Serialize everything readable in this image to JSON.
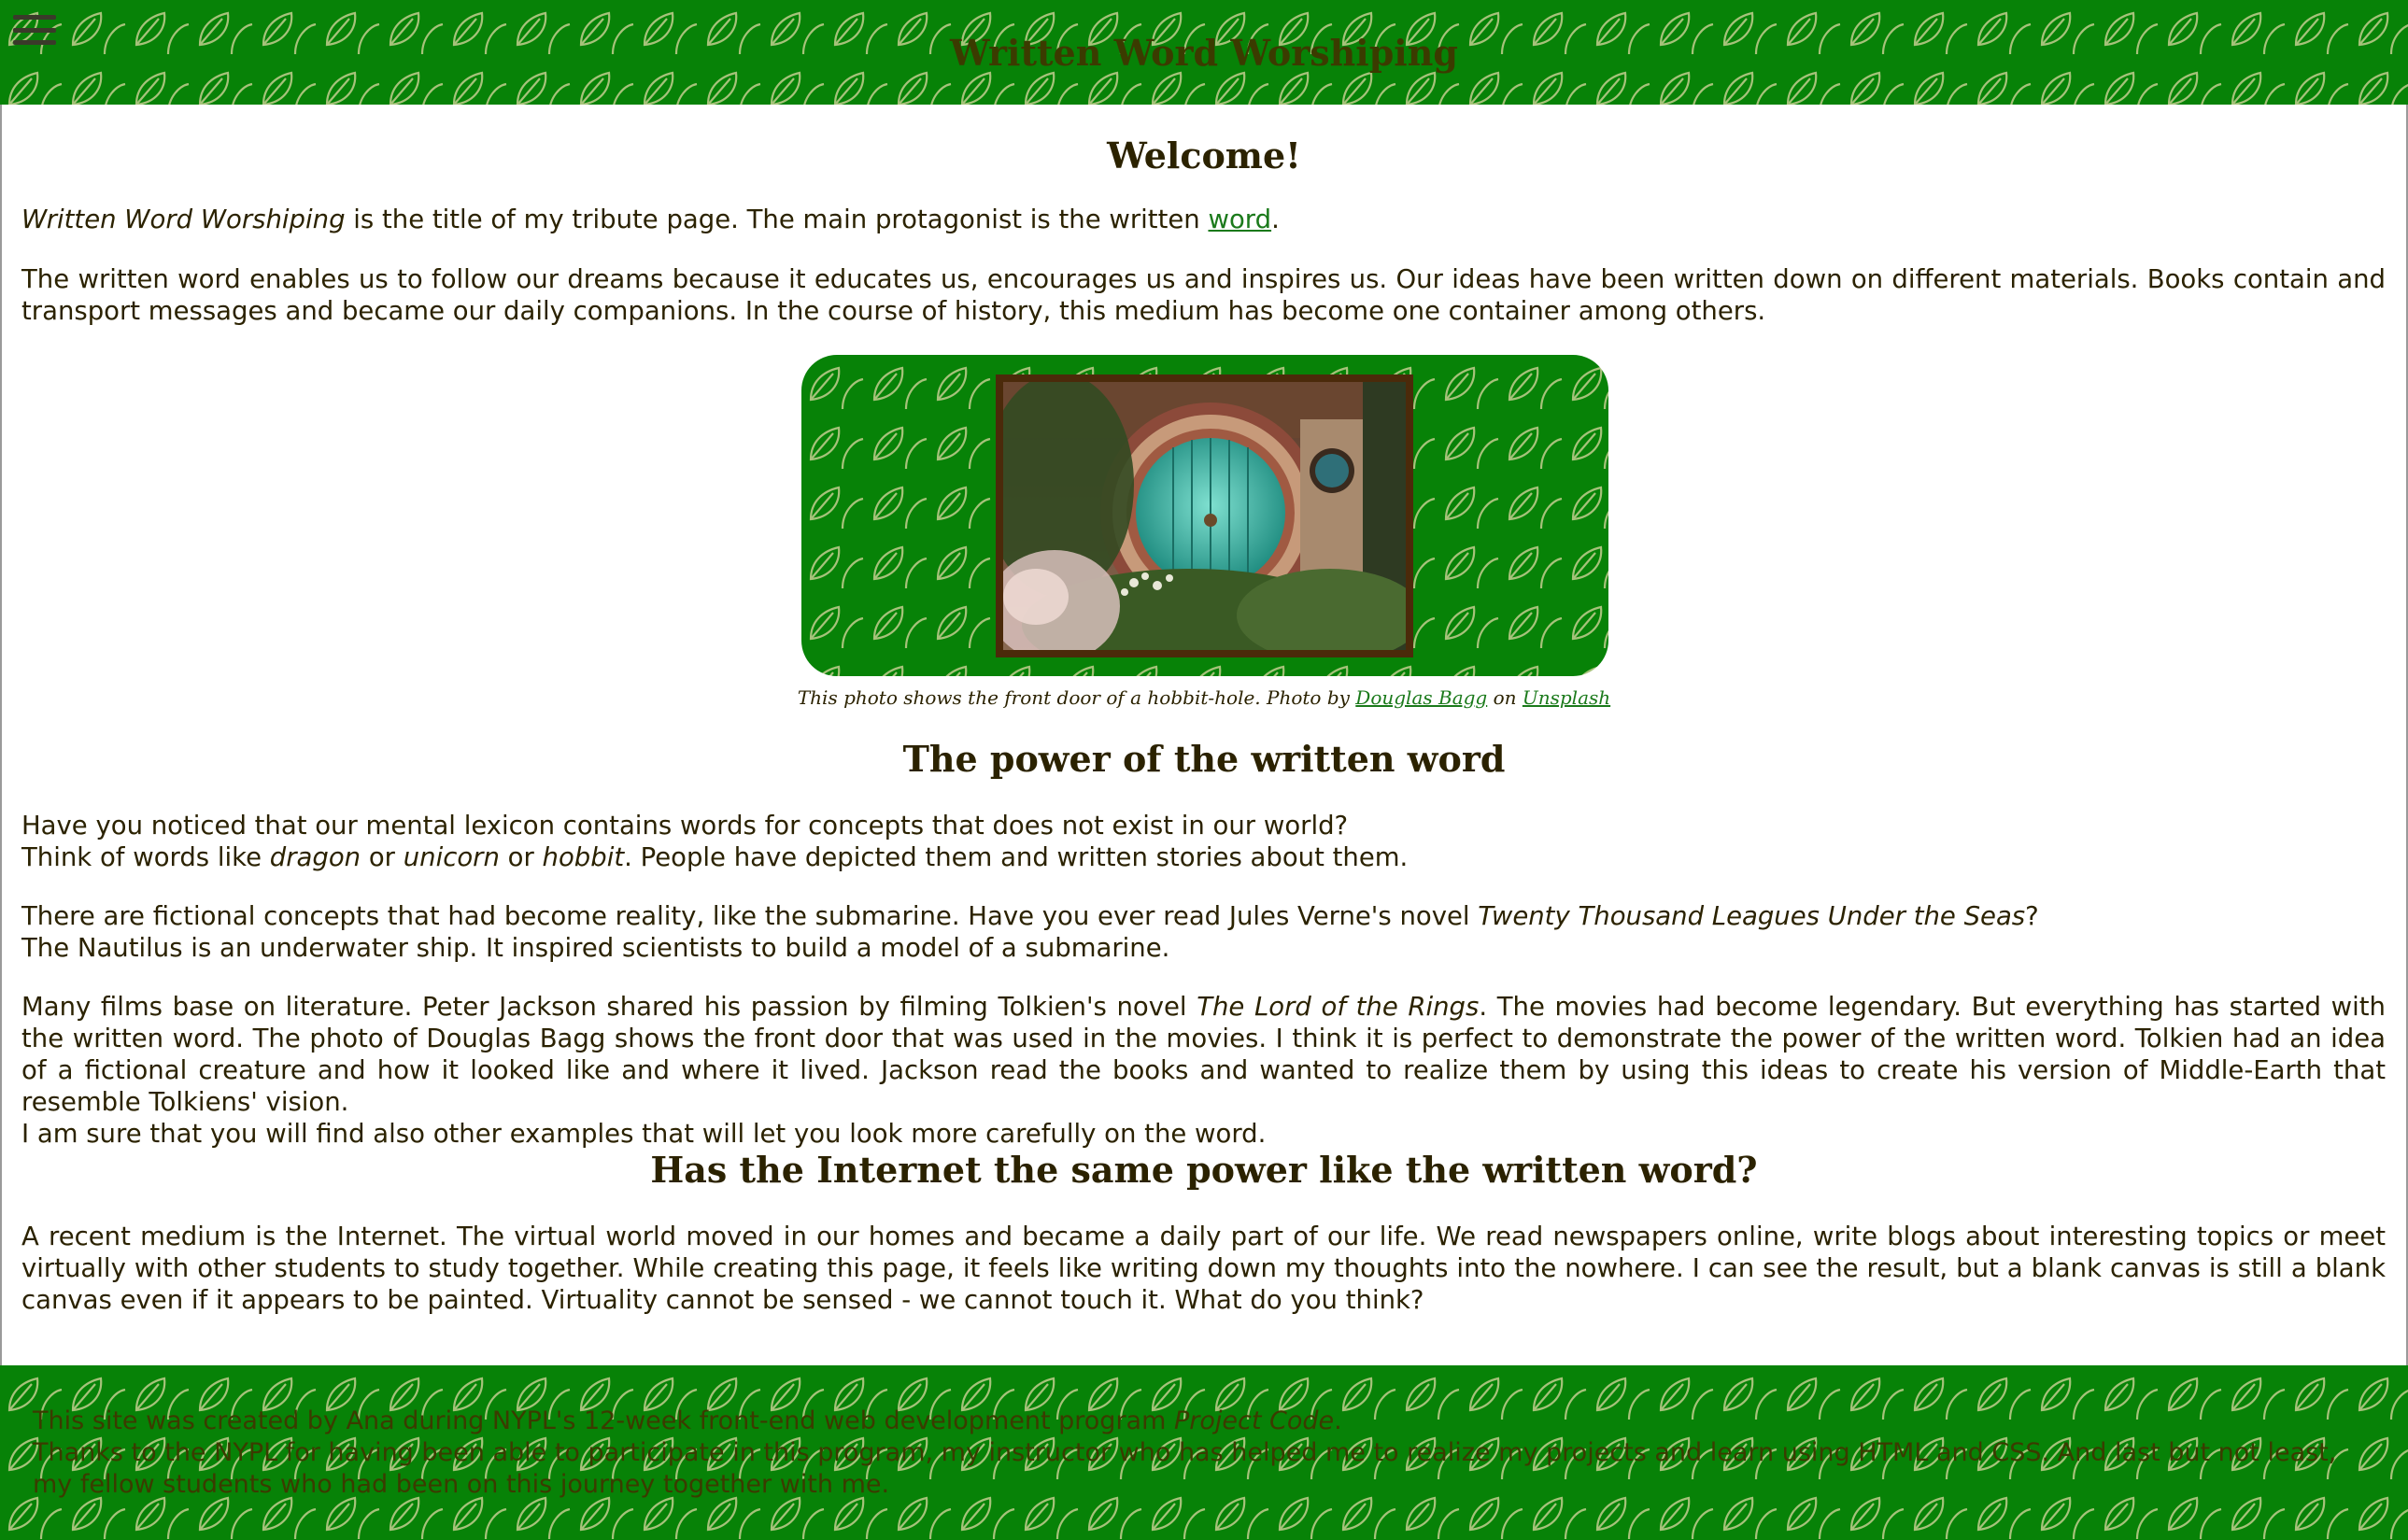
{
  "header": {
    "title": "Written Word Worshiping",
    "menu_icon": "hamburger-menu-icon"
  },
  "intro": {
    "heading": "Welcome!",
    "p1_title": "Written Word Worshiping",
    "p1_text": " is the title of my tribute page. The main protagonist is the written ",
    "p1_link": "word",
    "p1_end": ".",
    "p2": "The written word enables us to follow our dreams because it educates us, encourages us and inspires us. Our ideas have been written down on different materials. Books contain and transport messages and became our daily companions. In the course of history, this medium has become one container among others."
  },
  "figure": {
    "caption_text": "This photo shows the front door of a hobbit-hole. Photo by ",
    "caption_author": "Douglas Bagg",
    "caption_on": " on ",
    "caption_site": "Unsplash"
  },
  "power": {
    "heading": "The power of the written word",
    "p1_a": "Have you noticed that our mental lexicon contains words for concepts that does not exist in our world?",
    "p1_b": "Think of words like ",
    "w_dragon": "dragon",
    "w_or1": " or ",
    "w_unicorn": "unicorn",
    "w_or2": " or ",
    "w_hobbit": "hobbit",
    "p1_c": ". People have depicted them and written stories about them.",
    "p2_a": "There are fictional concepts that had become reality, like the submarine. Have you ever read Jules Verne's novel ",
    "p2_book": "Twenty Thousand Leagues Under the Seas",
    "p2_q": "?",
    "p2_b": "The Nautilus is an underwater ship. It inspired scientists to build a model of a submarine.",
    "p3_a": "Many films base on literature. Peter Jackson shared his passion by filming Tolkien's novel ",
    "p3_book": "The Lord of the Rings",
    "p3_b": ". The movies had become legendary. But everything has started with the written word. The photo of Douglas Bagg shows the front door that was used in the movies. I think it is perfect to demonstrate the power of the written word. Tolkien had an idea of a fictional creature and how it looked like and where it lived. Jackson read the books and wanted to realize them by using this ideas to create his version of Middle-Earth that resemble Tolkiens' vision.",
    "p3_c": "I am sure that you will find also other examples that will let you look more carefully on the word."
  },
  "internet": {
    "heading": "Has the Internet the same power like the written word?",
    "p1": "A recent medium is the Internet. The virtual world moved in our homes and became a daily part of our life. We read newspapers online, write blogs about interesting topics or meet virtually with other students to study together. While creating this page, it feels like writing down my thoughts into the nowhere. I can see the result, but a blank canvas is still a blank canvas even if it appears to be painted. Virtuality cannot be sensed - we cannot touch it. What do you think?"
  },
  "footer": {
    "line1_a": "This site was created by Ana during NYPL's 12-week front-end web development program ",
    "line1_program": "Project Code",
    "line1_end": ".",
    "line2": "Thanks to the NYPL for having been able to participate in this program, my instructor who has helped me to realize my projects and learn using HTML and CSS. And last but not least, my fellow students who had been on this journey together with me."
  },
  "colors": {
    "brand_green": "#078207",
    "text": "#2b2200",
    "link": "#1b7a1b",
    "photo_border": "#4b2a0a"
  }
}
